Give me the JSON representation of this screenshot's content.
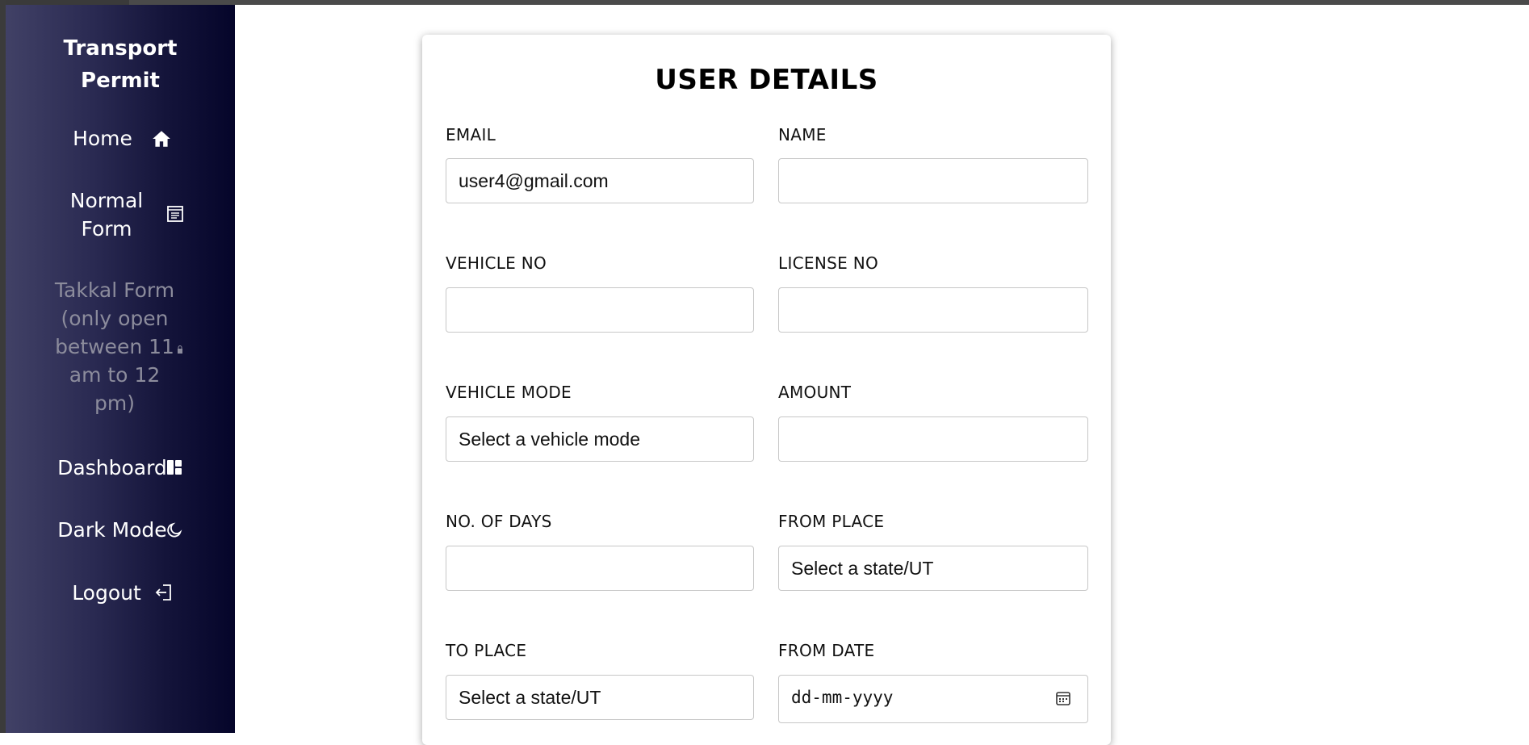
{
  "sidebar": {
    "brand": {
      "line1": "Transport",
      "line2": "Permit"
    },
    "items": [
      {
        "lines": [
          "Home"
        ],
        "icon": "home-icon"
      },
      {
        "lines": [
          "Normal",
          "Form"
        ],
        "icon": "form-icon"
      },
      {
        "lines": [
          "Takkal Form",
          "(only open",
          "between 11",
          "am to 12",
          "pm)"
        ],
        "icon": "lock-icon",
        "disabled": true
      },
      {
        "lines": [
          "Dashboard"
        ],
        "icon": "dashboard-icon"
      },
      {
        "lines": [
          "Dark Mode"
        ],
        "icon": "moon-icon"
      },
      {
        "lines": [
          "Logout"
        ],
        "icon": "logout-icon"
      }
    ]
  },
  "form": {
    "title": "USER DETAILS",
    "fields": {
      "email": {
        "label": "EMAIL",
        "value": "user4@gmail.com"
      },
      "name": {
        "label": "NAME",
        "value": ""
      },
      "vehicle_no": {
        "label": "VEHICLE NO",
        "value": ""
      },
      "license_no": {
        "label": "LICENSE NO",
        "value": ""
      },
      "vehicle_mode": {
        "label": "VEHICLE MODE",
        "value": "Select a vehicle mode"
      },
      "amount": {
        "label": "AMOUNT",
        "value": ""
      },
      "no_of_days": {
        "label": "NO. OF DAYS",
        "value": ""
      },
      "from_place": {
        "label": "FROM PLACE",
        "value": "Select a state/UT"
      },
      "to_place": {
        "label": "TO PLACE",
        "value": "Select a state/UT"
      },
      "from_date": {
        "label": "FROM DATE",
        "value": "dd-mm-yyyy"
      }
    }
  },
  "colors": {
    "sidebar_gradient_start": "#414166",
    "sidebar_gradient_end": "#05052a",
    "disabled_text": "#8c8c9c"
  }
}
